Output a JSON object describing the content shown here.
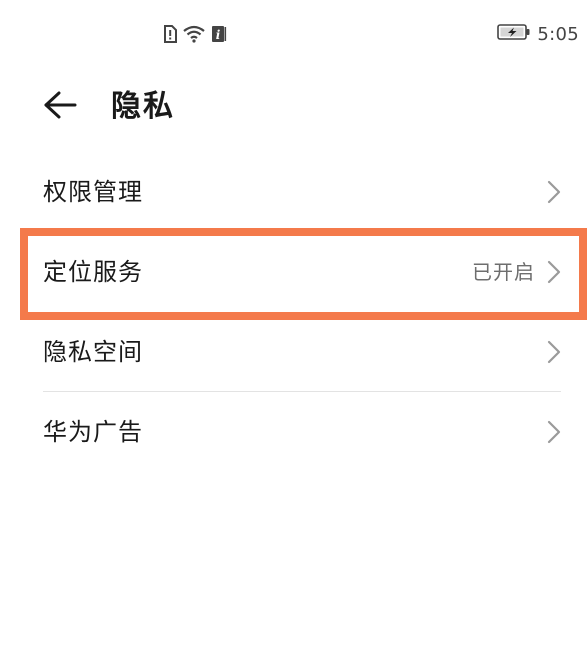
{
  "status_bar": {
    "time": "5:05",
    "icons": [
      "sim-alert-icon",
      "wifi-icon",
      "info-icon",
      "battery-charging-icon"
    ],
    "info_glyph": "i"
  },
  "header": {
    "title": "隐私",
    "back_icon": "arrow-left-icon"
  },
  "list": {
    "items": [
      {
        "label": "权限管理",
        "value": ""
      },
      {
        "label": "定位服务",
        "value": "已开启"
      },
      {
        "label": "隐私空间",
        "value": ""
      },
      {
        "label": "华为广告",
        "value": ""
      }
    ]
  },
  "colors": {
    "highlight": "#f47a4b",
    "text_primary": "#1a1a1a",
    "text_secondary": "#6e6e6e",
    "chevron": "#9a9a9a",
    "divider": "#e3e3e3"
  }
}
